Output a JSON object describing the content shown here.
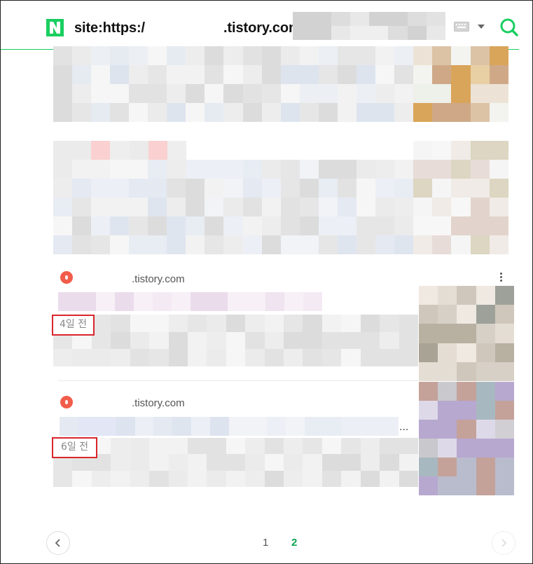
{
  "header": {
    "logo_letter": "N",
    "query_prefix": "site:https:/",
    "query_suffix": ".tistory.com"
  },
  "results": [
    {
      "site_suffix": ".tistory.com",
      "date": "4일 전"
    },
    {
      "site_suffix": ".tistory.com",
      "date": "6일 전",
      "more": "..."
    }
  ],
  "pagination": {
    "pages": [
      "1",
      "2"
    ],
    "current": "2"
  },
  "colors": {
    "accent": "#19ce60",
    "highlight_border": "#d9262c",
    "favicon": "#f25c4a"
  }
}
